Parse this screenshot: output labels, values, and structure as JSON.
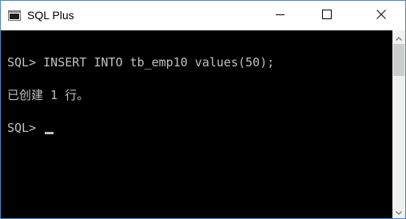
{
  "window": {
    "title": "SQL Plus",
    "app_icon": "console-window-icon",
    "controls": {
      "minimize_icon": "minimize-icon",
      "maximize_icon": "maximize-icon",
      "close_icon": "close-icon"
    }
  },
  "console": {
    "lines": [
      "SQL> INSERT INTO tb_emp10 values(50);",
      "已创建 1 行。",
      "SQL> "
    ],
    "background": "#000000",
    "foreground": "#c0c0c0"
  },
  "scrollbar": {
    "up_icon": "scroll-up-arrow-icon",
    "down_icon": "scroll-down-arrow-icon"
  }
}
